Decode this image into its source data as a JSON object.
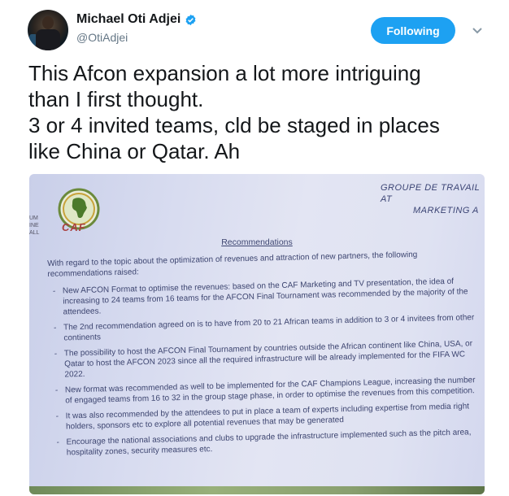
{
  "tweet": {
    "author_name": "Michael Oti Adjei",
    "handle": "@OtiAdjei",
    "follow_label": "Following",
    "text": "This Afcon expansion a lot more intriguing\nthan I first thought.\n3 or 4 invited teams, cld be staged in places\nlike China or Qatar. Ah"
  },
  "colors": {
    "accent": "#1da1f2",
    "text": "#14171a",
    "muted": "#657786"
  },
  "icons": {
    "verified": "verified-badge-icon",
    "menu": "chevron-down-icon"
  },
  "document": {
    "logo_text": "CAF",
    "side_text": "UM\nINE\nALL",
    "header_line1": "GROUPE DE TRAVAIL AT",
    "header_line2": "MARKETING A",
    "title": "Recommendations",
    "intro": "With regard to the topic about the optimization of revenues and attraction of new partners, the following recommendations raised:",
    "items": [
      "New AFCON Format to optimise the revenues: based on the CAF Marketing and TV presentation, the idea of increasing to 24 teams from 16 teams for the AFCON Final Tournament was recommended by the majority of the attendees.",
      "The 2nd recommendation agreed on is to have from 20 to 21 African teams in addition to 3 or 4 invitees from other continents",
      "The possibility to host the AFCON Final Tournament by countries outside the African continent like China, USA, or Qatar to host the AFCON 2023 since all the required infrastructure will be already implemented for the FIFA WC 2022.",
      "New format was recommended as well to be implemented for the CAF Champions League, increasing the number of engaged teams from 16 to 32 in the group stage phase, in order to optimise the revenues from this competition.",
      "It was also recommended by the attendees to put in place a team of experts including expertise from media right holders, sponsors etc to explore all potential revenues that may be generated",
      "Encourage the national associations and clubs to upgrade the infrastructure implemented such as the pitch area, hospitality zones, security measures etc."
    ]
  }
}
